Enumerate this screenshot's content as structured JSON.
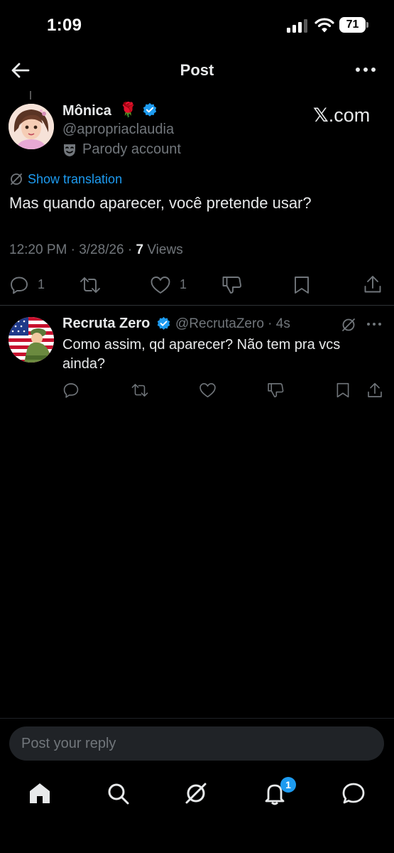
{
  "status_bar": {
    "time": "1:09",
    "battery": "71"
  },
  "header": {
    "title": "Post"
  },
  "post": {
    "author_name": "Mônica",
    "author_emoji": "🌹",
    "handle": "@apropriaclaudia",
    "parody_label": "Parody account",
    "source_label": ".com",
    "source_x": "𝕏",
    "translate_label": "Show translation",
    "text": "Mas quando aparecer, você pretende usar?",
    "timestamp": "12:20 PM · 3/28/26 · ",
    "views_count": "7",
    "views_label": " Views",
    "reply_count": "1",
    "like_count": "1"
  },
  "reply": {
    "author_name": "Recruta Zero",
    "handle_time": "@RecrutaZero · 4s",
    "text": "Como assim, qd aparecer? Não tem pra vcs ainda?"
  },
  "composer": {
    "placeholder": "Post your reply"
  },
  "nav": {
    "notification_badge": "1"
  },
  "colors": {
    "background": "#000000",
    "accent": "#1d9bf0",
    "muted": "#71767b",
    "text": "#e7e9ea"
  }
}
